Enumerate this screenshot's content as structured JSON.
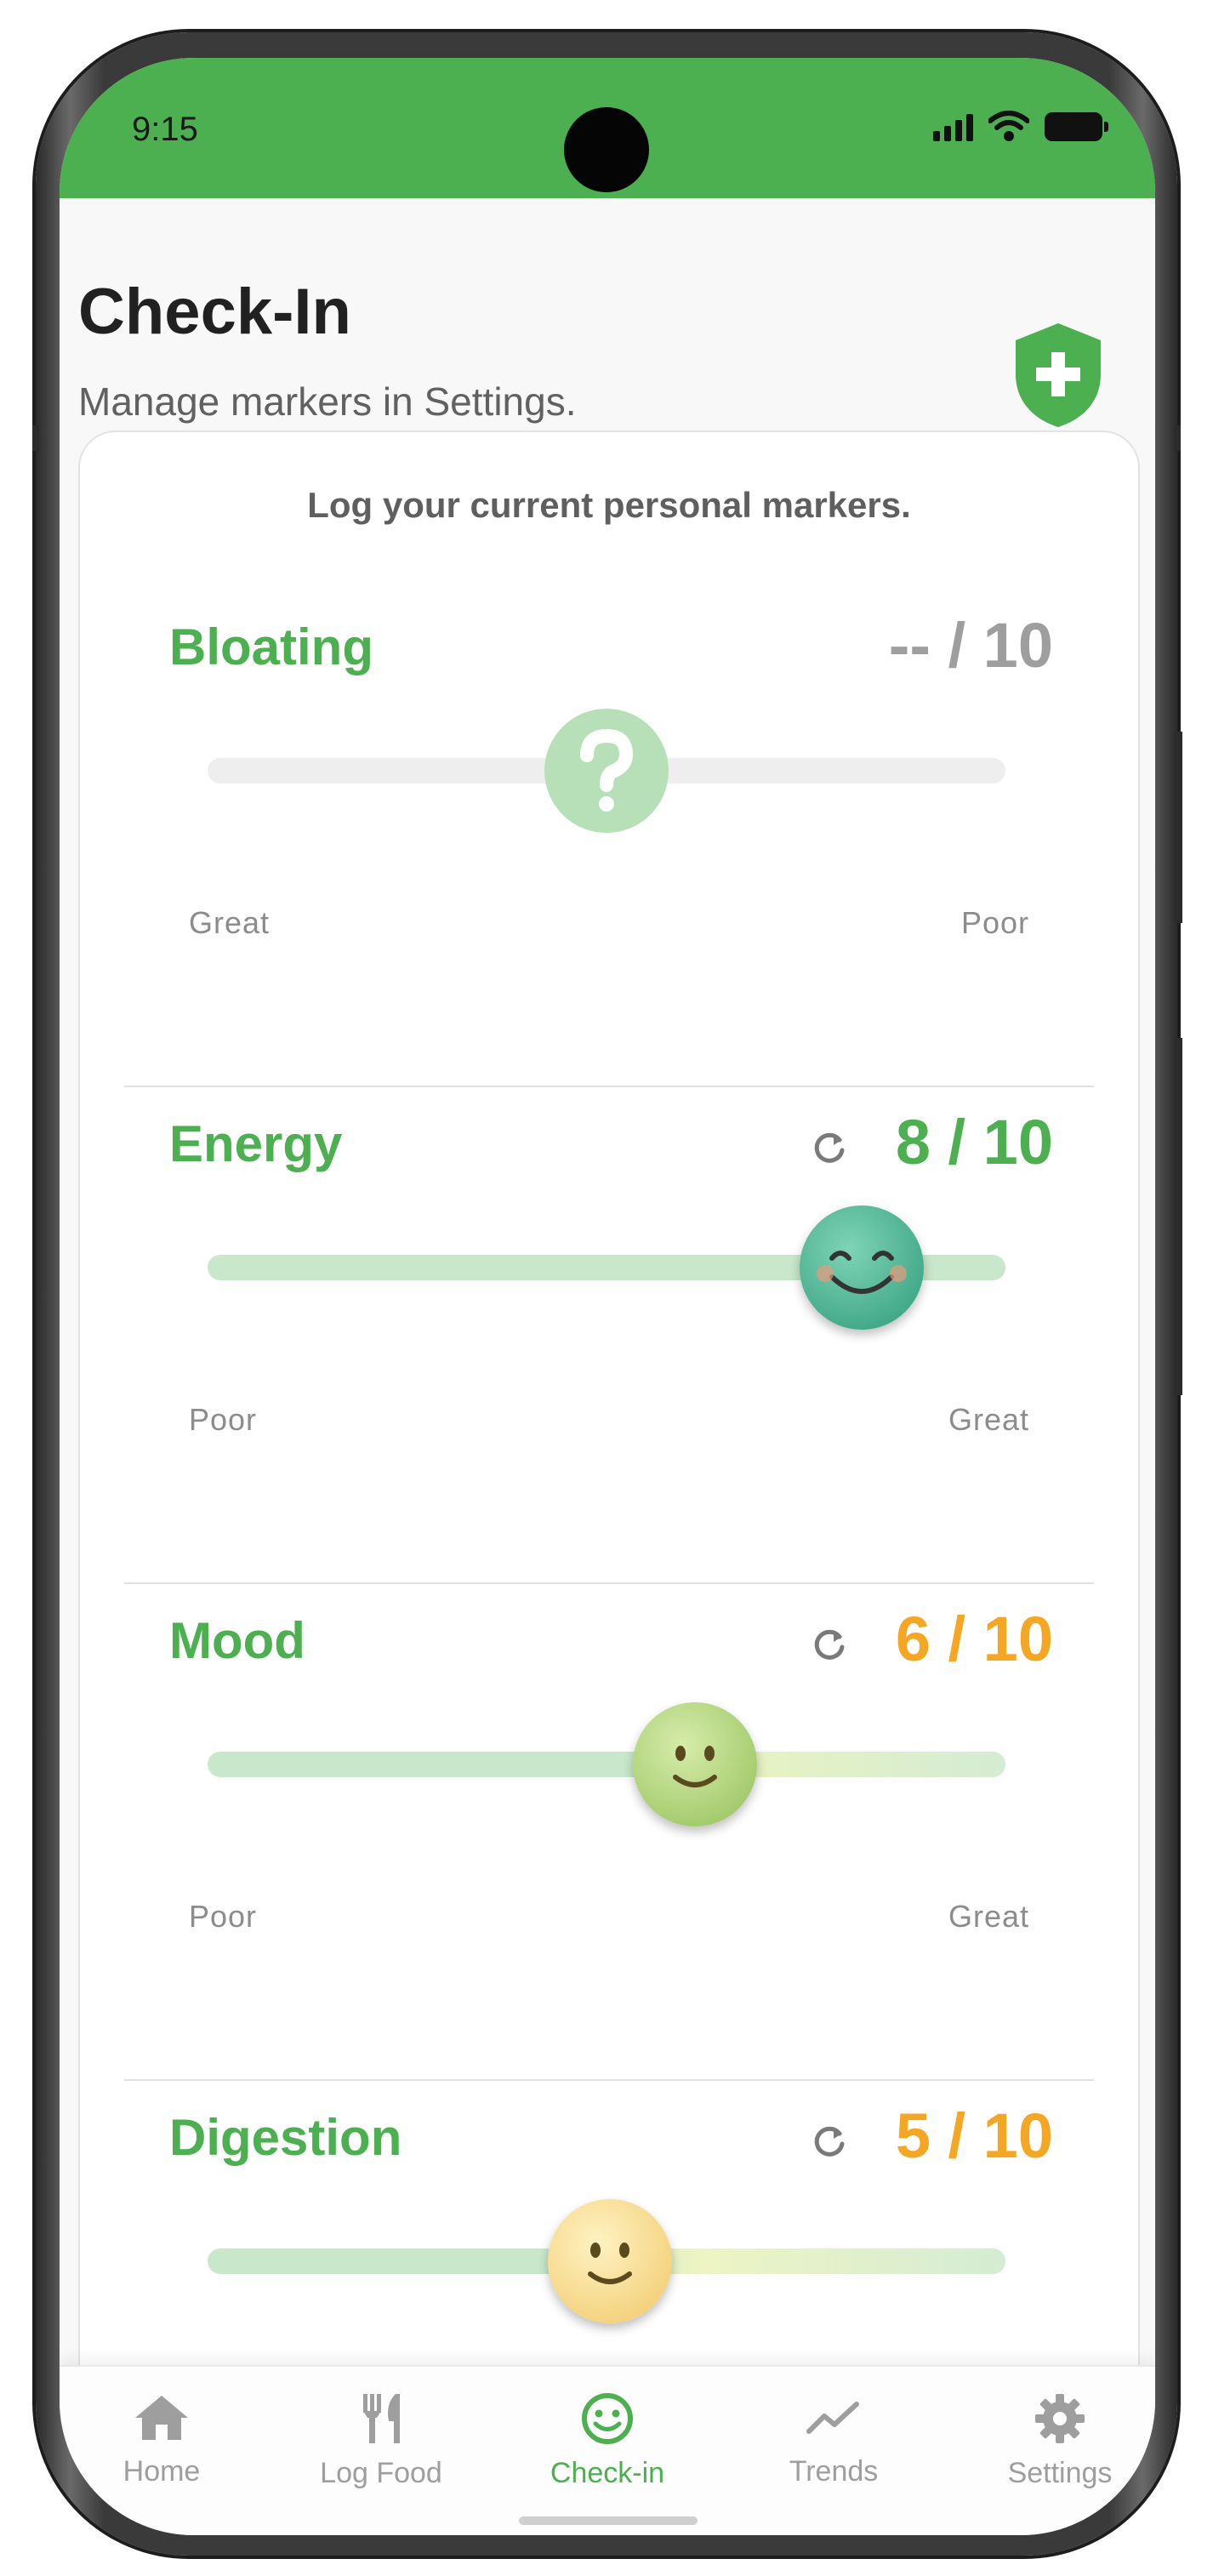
{
  "status_bar": {
    "time": "9:15"
  },
  "header": {
    "title": "Check-In",
    "subtitle": "Manage markers in Settings."
  },
  "card": {
    "intro": "Log your current personal markers."
  },
  "markers": [
    {
      "name": "Bloating",
      "value_text": "-- / 10",
      "value": null,
      "min_label": "Great",
      "max_label": "Poor",
      "value_color": "#9e9e9e"
    },
    {
      "name": "Energy",
      "value_text": "8 / 10",
      "value": 8,
      "min_label": "Poor",
      "max_label": "Great",
      "value_color": "#4caf50"
    },
    {
      "name": "Mood",
      "value_text": "6 / 10",
      "value": 6,
      "min_label": "Poor",
      "max_label": "Great",
      "value_color": "#f5a623"
    },
    {
      "name": "Digestion",
      "value_text": "5 / 10",
      "value": 5,
      "min_label": "",
      "max_label": "",
      "value_color": "#f5a623"
    }
  ],
  "nav": {
    "items": [
      {
        "label": "Home",
        "icon": "home-icon",
        "active": false
      },
      {
        "label": "Log Food",
        "icon": "fork-knife-icon",
        "active": false
      },
      {
        "label": "Check-in",
        "icon": "smiley-icon",
        "active": true
      },
      {
        "label": "Trends",
        "icon": "trend-line-icon",
        "active": false
      },
      {
        "label": "Settings",
        "icon": "gear-icon",
        "active": false
      }
    ]
  },
  "colors": {
    "brand": "#4caf50",
    "warning": "#f5a623",
    "muted": "#9e9e9e"
  }
}
